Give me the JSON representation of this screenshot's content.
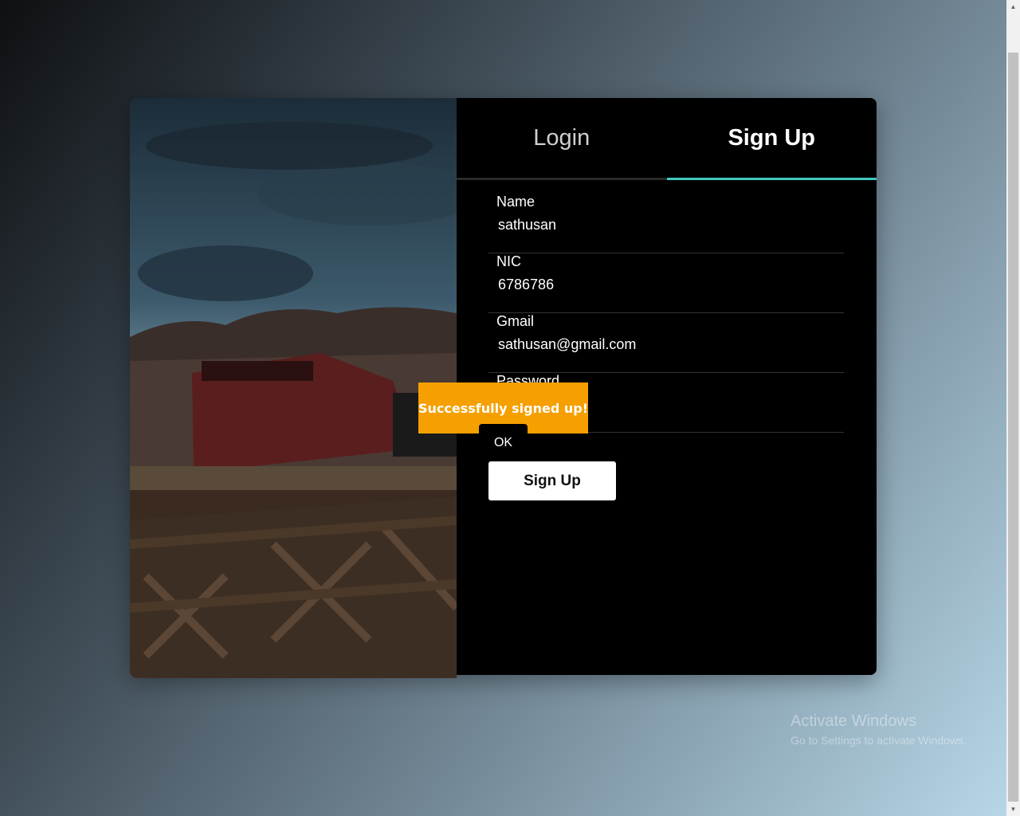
{
  "tabs": {
    "login_label": "Login",
    "signup_label": "Sign Up",
    "active": "signup"
  },
  "form": {
    "fields": [
      {
        "label": "Name",
        "value": "sathusan"
      },
      {
        "label": "NIC",
        "value": "6786786"
      },
      {
        "label": "Gmail",
        "value": "sathusan@gmail.com"
      },
      {
        "label": "Password",
        "value": ""
      }
    ],
    "submit_label": "Sign Up"
  },
  "toast": {
    "message": "Successfully signed up!",
    "ok_label": "OK",
    "color": "#f5a000"
  },
  "watermark": {
    "title": "Activate Windows",
    "subtitle": "Go to Settings to activate Windows."
  },
  "colors": {
    "accent": "#3ec8c0",
    "panel_bg": "#000000"
  },
  "scrollbar": {
    "up_icon": "scroll-up-arrow-icon",
    "down_icon": "scroll-down-arrow-icon"
  }
}
